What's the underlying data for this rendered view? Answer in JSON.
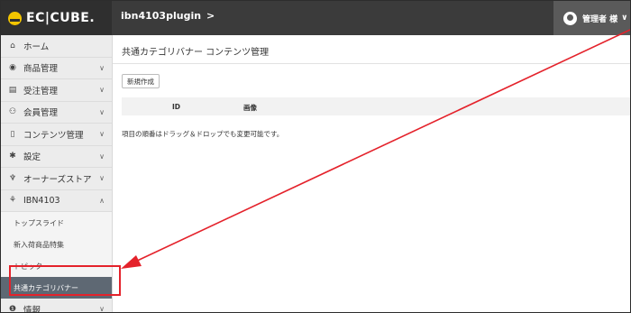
{
  "header": {
    "logo_text": "EC|CUBE.",
    "shop_name": "ibn4103plugin",
    "shop_chevron": ">",
    "user_label": "管理者 様",
    "user_chevron": "∨"
  },
  "sidebar": {
    "items": [
      {
        "icon": "home-icon",
        "glyph": "⌂",
        "label": "ホーム",
        "chevron": ""
      },
      {
        "icon": "product-icon",
        "glyph": "◉",
        "label": "商品管理",
        "chevron": "∨"
      },
      {
        "icon": "cart-icon",
        "glyph": "▤",
        "label": "受注管理",
        "chevron": "∨"
      },
      {
        "icon": "users-icon",
        "glyph": "⚇",
        "label": "会員管理",
        "chevron": "∨"
      },
      {
        "icon": "file-icon",
        "glyph": "▯",
        "label": "コンテンツ管理",
        "chevron": "∨"
      },
      {
        "icon": "gear-icon",
        "glyph": "✱",
        "label": "設定",
        "chevron": "∨"
      },
      {
        "icon": "plug-icon",
        "glyph": "♆",
        "label": "オーナーズストア",
        "chevron": "∨"
      },
      {
        "icon": "plugin-icon",
        "glyph": "⚘",
        "label": "IBN4103",
        "chevron": "∧"
      }
    ],
    "subitems": [
      {
        "label": "トップスライド"
      },
      {
        "label": "新入荷商品特集"
      },
      {
        "label": "トピック"
      },
      {
        "label": "共通カテゴリバナー"
      }
    ],
    "last_item": {
      "icon": "info-icon",
      "glyph": "❶",
      "label": "情報",
      "chevron": "∨"
    }
  },
  "main": {
    "page_title": "共通カテゴリバナー コンテンツ管理",
    "new_button": "新規作成",
    "table_headers": [
      "ID",
      "画像"
    ],
    "note": "項目の順番はドラッグ＆ドロップでも変更可能です。"
  },
  "colors": {
    "annotation": "#e4222b",
    "active_item": "#5e6873",
    "header": "#3b3b3b"
  }
}
